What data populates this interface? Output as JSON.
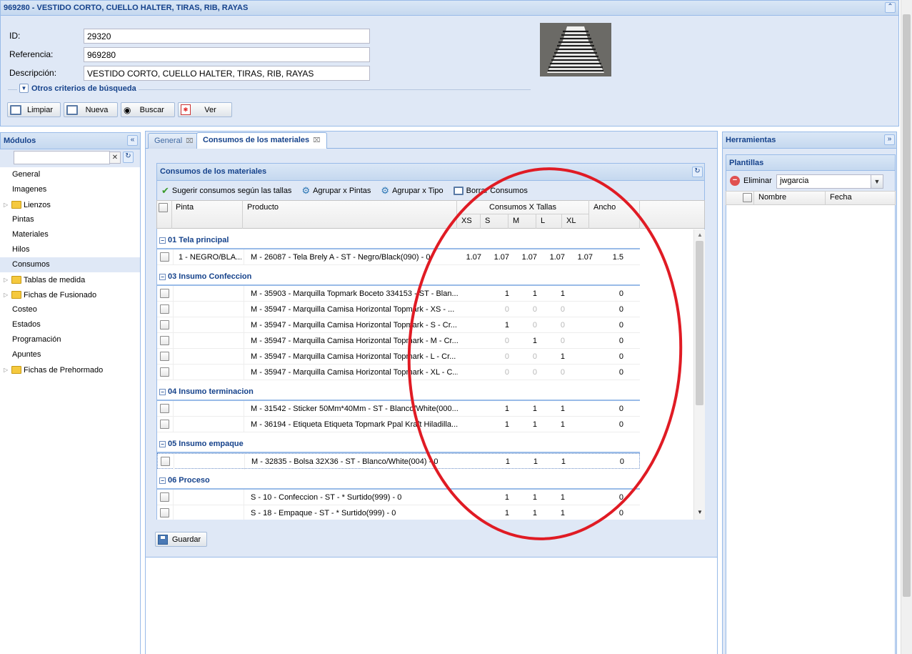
{
  "window": {
    "title": "969280 - VESTIDO CORTO, CUELLO HALTER, TIRAS, RIB, RAYAS"
  },
  "form": {
    "id_label": "ID:",
    "id_value": "29320",
    "ref_label": "Referencia:",
    "ref_value": "969280",
    "desc_label": "Descripción:",
    "desc_value": "VESTIDO CORTO, CUELLO HALTER, TIRAS, RIB, RAYAS",
    "otros_label": "Otros criterios de búsqueda"
  },
  "toolbar": {
    "limpiar": "Limpiar",
    "nueva": "Nueva",
    "buscar": "Buscar",
    "ver": "Ver"
  },
  "modules": {
    "title": "Módulos",
    "search_placeholder": "",
    "items": [
      {
        "label": "General",
        "folder": false,
        "selected": false
      },
      {
        "label": "Imagenes",
        "folder": false,
        "selected": false
      },
      {
        "label": "Lienzos",
        "folder": true,
        "selected": false
      },
      {
        "label": "Pintas",
        "folder": false,
        "selected": false
      },
      {
        "label": "Materiales",
        "folder": false,
        "selected": false
      },
      {
        "label": "Hilos",
        "folder": false,
        "selected": false
      },
      {
        "label": "Consumos",
        "folder": false,
        "selected": true
      },
      {
        "label": "Tablas de medida",
        "folder": true,
        "selected": false
      },
      {
        "label": "Fichas de Fusionado",
        "folder": true,
        "selected": false
      },
      {
        "label": "Costeo",
        "folder": false,
        "selected": false
      },
      {
        "label": "Estados",
        "folder": false,
        "selected": false
      },
      {
        "label": "Programación",
        "folder": false,
        "selected": false
      },
      {
        "label": "Apuntes",
        "folder": false,
        "selected": false
      },
      {
        "label": "Fichas de Prehormado",
        "folder": true,
        "selected": false
      }
    ]
  },
  "tabs": [
    {
      "label": "General",
      "active": false
    },
    {
      "label": "Consumos de los materiales",
      "active": true
    }
  ],
  "consumos": {
    "title": "Consumos de los materiales",
    "actions": {
      "sugerir": "Sugerir consumos según las tallas",
      "agrupar_pintas": "Agrupar x Pintas",
      "agrupar_tipo": "Agrupar x Tipo",
      "borrar": "Borrar Consumos"
    },
    "columns": {
      "pinta": "Pinta",
      "producto": "Producto",
      "tallas_group": "Consumos X Tallas",
      "sizes": [
        "XS",
        "S",
        "M",
        "L",
        "XL"
      ],
      "ancho": "Ancho"
    },
    "groups": [
      {
        "name": "01 Tela principal",
        "rows": [
          {
            "pinta": "1 - NEGRO/BLA...",
            "producto": "M - 26087 - Tela Brely A - ST - Negro/Black(090) - 0",
            "sizes": [
              "1.07",
              "1.07",
              "1.07",
              "1.07",
              "1.07"
            ],
            "ancho": "1.5",
            "gray": [
              false,
              false,
              false,
              false,
              false
            ]
          }
        ]
      },
      {
        "name": "03 Insumo Confeccion",
        "rows": [
          {
            "pinta": "",
            "producto": "M - 35903 - Marquilla Topmark Boceto 334153 - ST - Blan...",
            "sizes": [
              "",
              "1",
              "1",
              "1",
              ""
            ],
            "ancho": "0",
            "gray": [
              false,
              false,
              false,
              false,
              false
            ]
          },
          {
            "pinta": "",
            "producto": "M - 35947 - Marquilla Camisa Horizontal Topmark - XS - ...",
            "sizes": [
              "",
              "0",
              "0",
              "0",
              ""
            ],
            "ancho": "0",
            "gray": [
              false,
              true,
              true,
              true,
              false
            ]
          },
          {
            "pinta": "",
            "producto": "M - 35947 - Marquilla Camisa Horizontal Topmark - S - Cr...",
            "sizes": [
              "",
              "1",
              "0",
              "0",
              ""
            ],
            "ancho": "0",
            "gray": [
              false,
              false,
              true,
              true,
              false
            ]
          },
          {
            "pinta": "",
            "producto": "M - 35947 - Marquilla Camisa Horizontal Topmark - M - Cr...",
            "sizes": [
              "",
              "0",
              "1",
              "0",
              ""
            ],
            "ancho": "0",
            "gray": [
              false,
              true,
              false,
              true,
              false
            ]
          },
          {
            "pinta": "",
            "producto": "M - 35947 - Marquilla Camisa Horizontal Topmark - L - Cr...",
            "sizes": [
              "",
              "0",
              "0",
              "1",
              ""
            ],
            "ancho": "0",
            "gray": [
              false,
              true,
              true,
              false,
              false
            ]
          },
          {
            "pinta": "",
            "producto": "M - 35947 - Marquilla Camisa Horizontal Topmark - XL - C...",
            "sizes": [
              "",
              "0",
              "0",
              "0",
              ""
            ],
            "ancho": "0",
            "gray": [
              false,
              true,
              true,
              true,
              false
            ]
          }
        ]
      },
      {
        "name": "04 Insumo terminacion",
        "rows": [
          {
            "pinta": "",
            "producto": "M - 31542 - Sticker 50Mm*40Mm - ST - Blanco/White(000...",
            "sizes": [
              "",
              "1",
              "1",
              "1",
              ""
            ],
            "ancho": "0",
            "gray": [
              false,
              false,
              false,
              false,
              false
            ]
          },
          {
            "pinta": "",
            "producto": "M - 36194 - Etiqueta Etiqueta Topmark Ppal Kraft Hiladilla...",
            "sizes": [
              "",
              "1",
              "1",
              "1",
              ""
            ],
            "ancho": "0",
            "gray": [
              false,
              false,
              false,
              false,
              false
            ]
          }
        ]
      },
      {
        "name": "05 Insumo empaque",
        "rows": [
          {
            "pinta": "",
            "producto": "M - 32835 - Bolsa 32X36 - ST - Blanco/White(004) - 0",
            "sizes": [
              "",
              "1",
              "1",
              "1",
              ""
            ],
            "ancho": "0",
            "gray": [
              false,
              false,
              false,
              false,
              false
            ]
          }
        ]
      },
      {
        "name": "06 Proceso",
        "rows": [
          {
            "pinta": "",
            "producto": "S - 10 - Confeccion - ST - * Surtido(999) - 0",
            "sizes": [
              "",
              "1",
              "1",
              "1",
              ""
            ],
            "ancho": "0",
            "gray": [
              false,
              false,
              false,
              false,
              false
            ]
          },
          {
            "pinta": "",
            "producto": "S - 18 - Empaque - ST - * Surtido(999) - 0",
            "sizes": [
              "",
              "1",
              "1",
              "1",
              ""
            ],
            "ancho": "0",
            "gray": [
              false,
              false,
              false,
              false,
              false
            ]
          }
        ]
      }
    ],
    "save": "Guardar"
  },
  "herramientas": {
    "title": "Herramientas",
    "plantillas": "Plantillas",
    "eliminar": "Eliminar",
    "user": "jwgarcia",
    "col_nombre": "Nombre",
    "col_fecha": "Fecha"
  },
  "colors": {
    "header_blue": "#15428b",
    "panel_bg": "#dfe8f6",
    "annotation_red": "#e01b24"
  }
}
